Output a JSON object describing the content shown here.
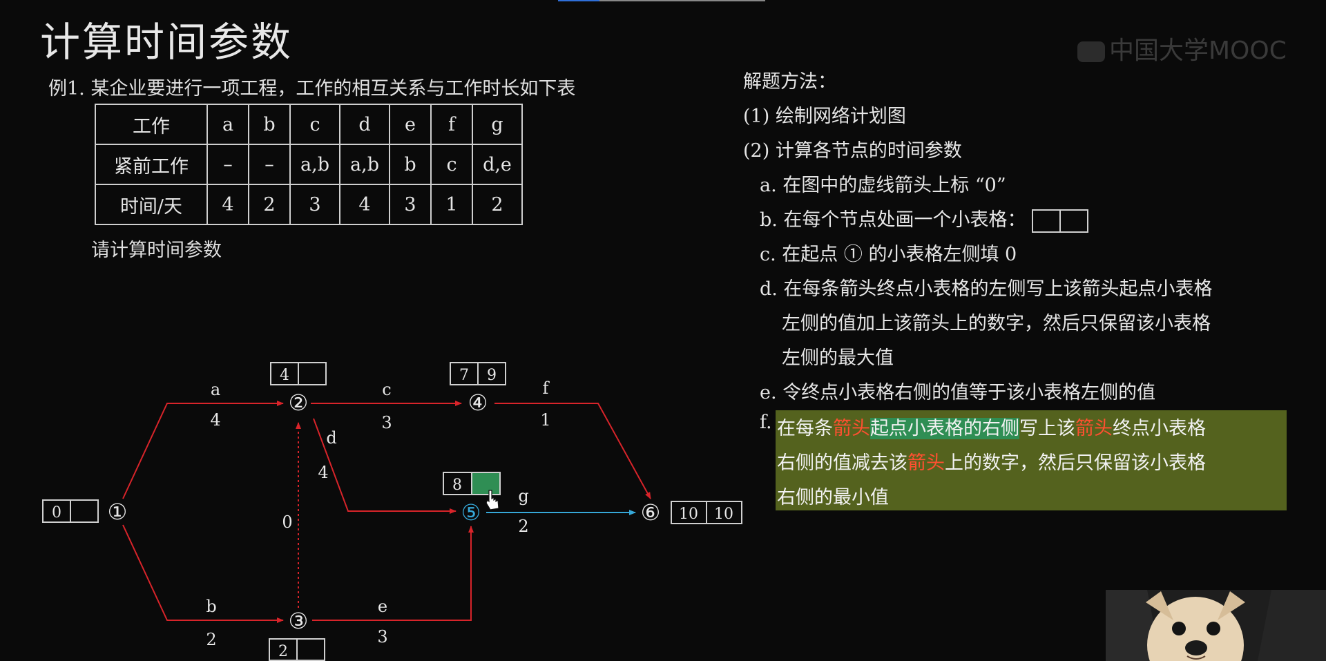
{
  "title": "计算时间参数",
  "watermark": "中国大学MOOC",
  "example": "例1. 某企业要进行一项工程，工作的相互关系与工作时长如下表",
  "table": {
    "rows": [
      [
        "工作",
        "a",
        "b",
        "c",
        "d",
        "e",
        "f",
        "g"
      ],
      [
        "紧前工作",
        "–",
        "–",
        "a,b",
        "a,b",
        "b",
        "c",
        "d,e"
      ],
      [
        "时间/天",
        "4",
        "2",
        "3",
        "4",
        "3",
        "1",
        "2"
      ]
    ]
  },
  "ask": "请计算时间参数",
  "diagram": {
    "nodes": {
      "n1": "①",
      "n2": "②",
      "n3": "③",
      "n4": "④",
      "n5": "⑤",
      "n6": "⑥"
    },
    "boxes": {
      "n1_left": "0",
      "n1_right": "",
      "n2_left": "4",
      "n2_right": "",
      "n3_left": "2",
      "n3_right": "",
      "n4_left": "7",
      "n4_right": "9",
      "n5_left": "8",
      "n5_right": "",
      "n6_left": "10",
      "n6_right": "10"
    },
    "edges": {
      "a": {
        "name": "a",
        "time": "4"
      },
      "b": {
        "name": "b",
        "time": "2"
      },
      "c": {
        "name": "c",
        "time": "3"
      },
      "d": {
        "name": "d",
        "time": "4"
      },
      "e": {
        "name": "e",
        "time": "3"
      },
      "f": {
        "name": "f",
        "time": "1"
      },
      "g": {
        "name": "g",
        "time": "2"
      },
      "dummy": {
        "time": "0"
      }
    },
    "colors": {
      "arrow": "#d8242a",
      "active": "#36a8d8",
      "box_fill": "#2f8e54"
    }
  },
  "method": {
    "heading": "解题方法：",
    "s1": "(1) 绘制网络计划图",
    "s2": "(2) 计算各节点的时间参数",
    "a": "a. 在图中的虚线箭头上标 “0”",
    "b": "b. 在每个节点处画一个小表格：",
    "c": "c. 在起点 ① 的小表格左侧填 0",
    "d1": "d. 在每条箭头终点小表格的左侧写上该箭头起点小表格",
    "d2": "左侧的值加上该箭头上的数字，然后只保留该小表格",
    "d3": "左侧的最大值",
    "e": "e. 令终点小表格右侧的值等于该小表格左侧的值",
    "f_label": "f.",
    "f1_a": "在每条",
    "f1_b": "箭头",
    "f1_c": "起点小表格的右侧",
    "f1_d": "写上该",
    "f1_e": "箭头",
    "f1_f": "终点小表格",
    "f2_a": "右侧的值减去该",
    "f2_b": "箭头",
    "f2_c": "上的数字，然后只保留该小表格",
    "f3": "右侧的最小值"
  }
}
